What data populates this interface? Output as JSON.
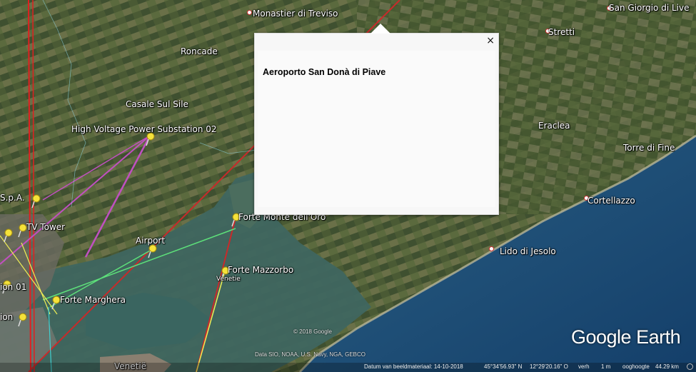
{
  "places": [
    {
      "label": "Monastier di Treviso",
      "cls": "place"
    },
    {
      "label": "San Giorgio di Live",
      "cls": "place"
    },
    {
      "label": "Roncade",
      "cls": "place"
    },
    {
      "label": "Stretti",
      "cls": "place"
    },
    {
      "label": "Casale Sul Sile",
      "cls": "place"
    },
    {
      "label": "High Voltage Power Substation 02",
      "cls": "place"
    },
    {
      "label": "Eraclea",
      "cls": "place"
    },
    {
      "label": "Torre di Fine",
      "cls": "place"
    },
    {
      "label": "Cortellazzo",
      "cls": "place"
    },
    {
      "label": "S.p.A.",
      "cls": "place"
    },
    {
      "label": "TV Tower",
      "cls": "place"
    },
    {
      "label": "Forte Monte dell'Oro",
      "cls": "place"
    },
    {
      "label": "Airport",
      "cls": "place"
    },
    {
      "label": "Lido di Jesolo",
      "cls": "place"
    },
    {
      "label": "Forte Mazzorbo",
      "cls": "place"
    },
    {
      "label": "Venetie",
      "cls": "place"
    },
    {
      "label": "Forte Marghera",
      "cls": "place"
    },
    {
      "label": "ion 01",
      "cls": "place"
    },
    {
      "label": "ion",
      "cls": "place"
    },
    {
      "label": "Venetië",
      "cls": "place"
    }
  ],
  "popup": {
    "title": "Aeroporto San Donà di Piave",
    "close_label": "×"
  },
  "logo_text": "Google Earth",
  "credits": {
    "copyright": "© 2018 Google",
    "data_sources": "Data SIO, NOAA, U.S. Navy, NGA, GEBCO"
  },
  "status": {
    "imagery_date": "Datum van beeldmateriaal: 14-10-2018",
    "lat": "45°34'56.93\" N",
    "lon": "12°29'20.16\" O",
    "elev_label": "verh",
    "elev": "1 m",
    "eye_alt_label": "ooghoogte",
    "eye_alt": "44.29 km"
  },
  "colors": {
    "popup_bg": "#f7f7f7",
    "land_dark": "#3a4a2c",
    "water": "#1f4d73",
    "lagoon": "#3e5f58"
  }
}
